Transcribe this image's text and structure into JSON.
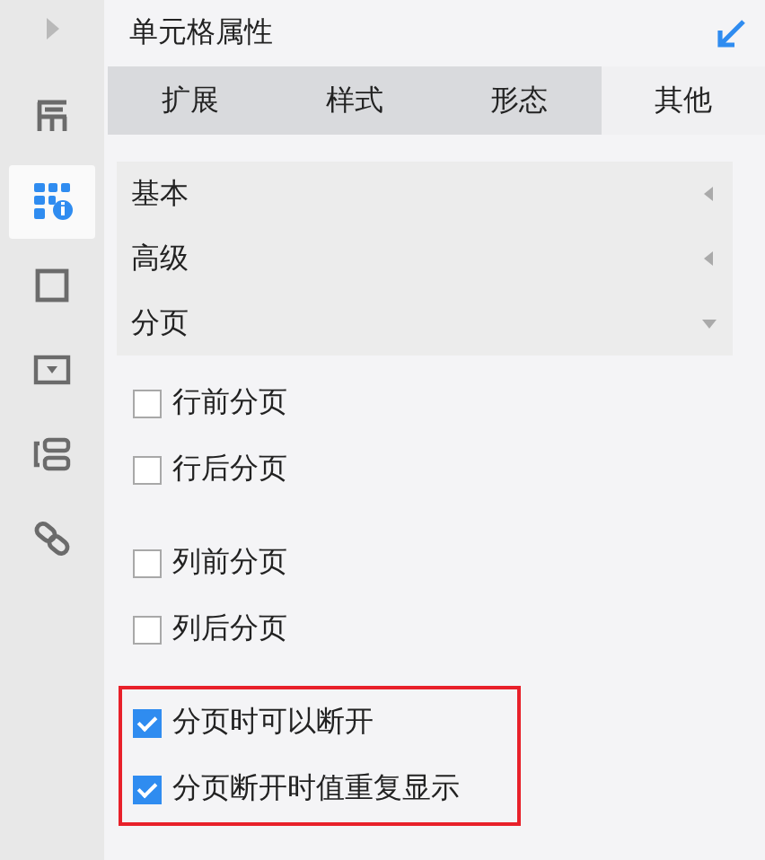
{
  "sidebar": {
    "items": [
      {
        "kind": "expand",
        "selected": false
      },
      {
        "kind": "layout",
        "selected": false
      },
      {
        "kind": "cell",
        "selected": true
      },
      {
        "kind": "frame",
        "selected": false
      },
      {
        "kind": "dropdown",
        "selected": false
      },
      {
        "kind": "stack",
        "selected": false
      },
      {
        "kind": "link",
        "selected": false
      }
    ]
  },
  "panel": {
    "title": "单元格属性"
  },
  "tabs": [
    {
      "label": "扩展",
      "selected": false
    },
    {
      "label": "样式",
      "selected": false
    },
    {
      "label": "形态",
      "selected": false
    },
    {
      "label": "其他",
      "selected": true
    }
  ],
  "sections": [
    {
      "label": "基本",
      "expanded": false
    },
    {
      "label": "高级",
      "expanded": false
    },
    {
      "label": "分页",
      "expanded": true
    }
  ],
  "option_groups": [
    {
      "highlighted": false,
      "options": [
        {
          "label": "行前分页",
          "checked": false
        },
        {
          "label": "行后分页",
          "checked": false
        }
      ]
    },
    {
      "highlighted": false,
      "options": [
        {
          "label": "列前分页",
          "checked": false
        },
        {
          "label": "列后分页",
          "checked": false
        }
      ]
    },
    {
      "highlighted": true,
      "options": [
        {
          "label": "分页时可以断开",
          "checked": true
        },
        {
          "label": "分页断开时值重复显示",
          "checked": true
        }
      ]
    }
  ]
}
